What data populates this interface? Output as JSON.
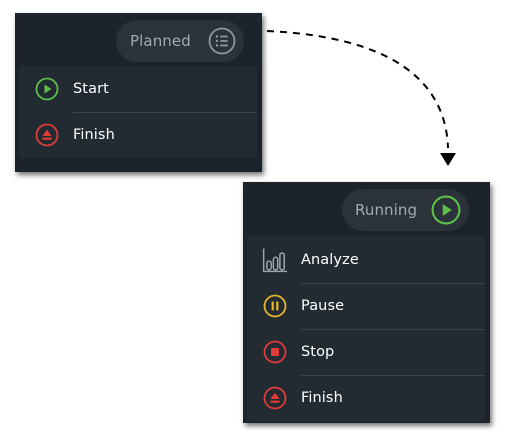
{
  "colors": {
    "panel_bg": "#1c232a",
    "menu_bg": "#222a32",
    "start_green": "#5cbf4a",
    "finish_red": "#e23b3b",
    "pause_yellow": "#e8b52a",
    "stop_red": "#e23b3b",
    "analyze_gray": "#9aa2aa"
  },
  "planned_menu": {
    "status_label": "Planned",
    "status_icon": "list-icon",
    "items": [
      {
        "label": "Start",
        "icon": "play-circle-icon"
      },
      {
        "label": "Finish",
        "icon": "eject-circle-icon"
      }
    ]
  },
  "running_menu": {
    "status_label": "Running",
    "status_icon": "play-circle-icon",
    "items": [
      {
        "label": "Analyze",
        "icon": "bar-chart-icon"
      },
      {
        "label": "Pause",
        "icon": "pause-circle-icon"
      },
      {
        "label": "Stop",
        "icon": "stop-circle-icon"
      },
      {
        "label": "Finish",
        "icon": "eject-circle-icon"
      }
    ]
  }
}
